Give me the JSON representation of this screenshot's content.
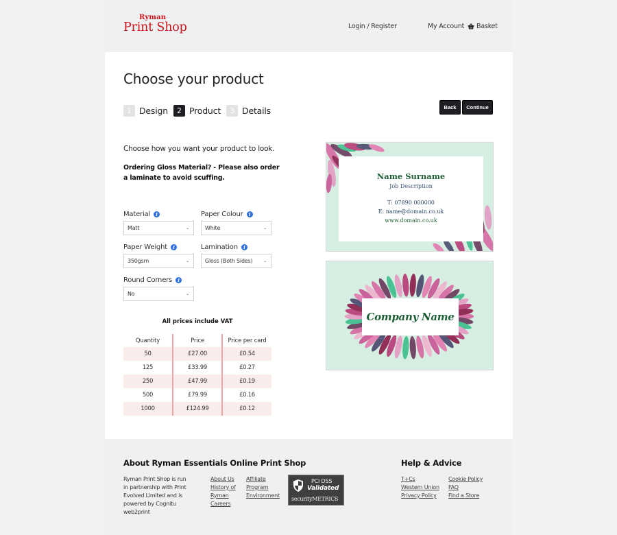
{
  "header": {
    "logo_small": "Ryman",
    "logo_big": "Print Shop",
    "login_register": "Login / Register",
    "my_account": "My Account",
    "basket": "Basket"
  },
  "main": {
    "title": "Choose your product",
    "steps": [
      {
        "num": "1",
        "label": "Design",
        "active": false
      },
      {
        "num": "2",
        "label": "Product",
        "active": true
      },
      {
        "num": "3",
        "label": "Details",
        "active": false
      }
    ],
    "back_label": "Back",
    "continue_label": "Continue",
    "intro": "Choose how you want your product to look.",
    "warning": "Ordering Gloss Material? - Please also order a laminate to avoid scuffing.",
    "fields": {
      "material": {
        "label": "Material",
        "value": "Matt"
      },
      "paper_colour": {
        "label": "Paper Colour",
        "value": "White"
      },
      "paper_weight": {
        "label": "Paper Weight",
        "value": "350gsm"
      },
      "lamination": {
        "label": "Lamination",
        "value": "Gloss (Both Sides)"
      },
      "round_corners": {
        "label": "Round Corners",
        "value": "No"
      }
    },
    "vat_note": "All prices include VAT",
    "price_table": {
      "headers": [
        "Quantity",
        "Price",
        "Price per card"
      ],
      "rows": [
        [
          "50",
          "£27.00",
          "£0.54"
        ],
        [
          "125",
          "£33.99",
          "£0.27"
        ],
        [
          "250",
          "£47.99",
          "£0.19"
        ],
        [
          "500",
          "£79.99",
          "£0.16"
        ],
        [
          "1000",
          "£124.99",
          "£0.12"
        ]
      ]
    }
  },
  "preview": {
    "front": {
      "name": "Name Surname",
      "job": "Job Description",
      "phone": "T: 07890 000000",
      "email": "E: name@domain.co.uk",
      "web": "www.domain.co.uk"
    },
    "back": {
      "company": "Company Name"
    }
  },
  "footer": {
    "about_title": "About Ryman Essentials Online Print Shop",
    "about_text": "Ryman Print Shop is run in partnership with Print Evolved Limited and is powered by Cognitu web2print",
    "links_col1": [
      "About Us",
      "History of Ryman",
      "Careers"
    ],
    "links_col2": [
      "Affiliate Program",
      "Environment"
    ],
    "pci": {
      "line1": "PCI DSS",
      "line2": "Validated",
      "line3": "securityMETRICS"
    },
    "help_title": "Help & Advice",
    "help_col1": [
      "T+Cs",
      "Western Union",
      "Privacy Policy"
    ],
    "help_col2": [
      "Cookie Policy",
      "FAQ",
      "Find a Store"
    ]
  }
}
